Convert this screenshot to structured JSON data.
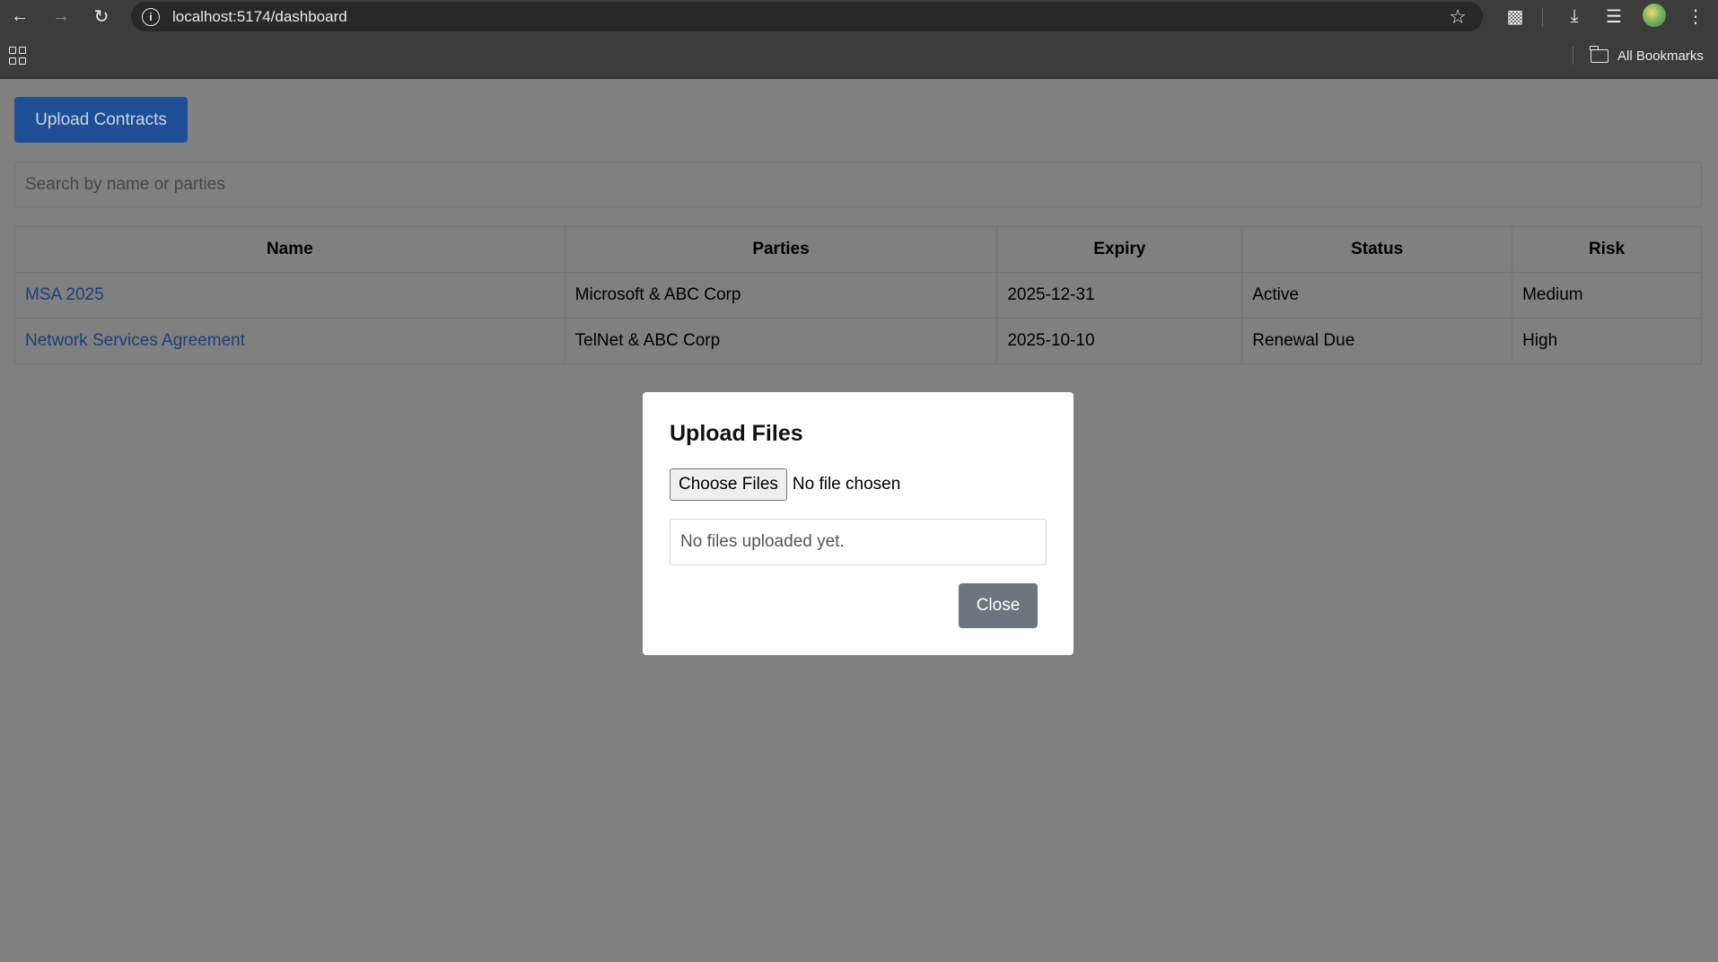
{
  "browser": {
    "url": "localhost:5174/dashboard",
    "all_bookmarks_label": "All Bookmarks"
  },
  "page": {
    "upload_button_label": "Upload Contracts",
    "search_placeholder": "Search by name or parties",
    "table": {
      "columns": [
        "Name",
        "Parties",
        "Expiry",
        "Status",
        "Risk"
      ],
      "rows": [
        {
          "name": "MSA 2025",
          "parties": "Microsoft & ABC Corp",
          "expiry": "2025-12-31",
          "status": "Active",
          "risk": "Medium"
        },
        {
          "name": "Network Services Agreement",
          "parties": "TelNet & ABC Corp",
          "expiry": "2025-10-10",
          "status": "Renewal Due",
          "risk": "High"
        }
      ]
    }
  },
  "modal": {
    "title": "Upload Files",
    "choose_files_label": "Choose Files",
    "file_status": "No file chosen",
    "uploads_empty_text": "No files uploaded yet.",
    "close_label": "Close"
  }
}
